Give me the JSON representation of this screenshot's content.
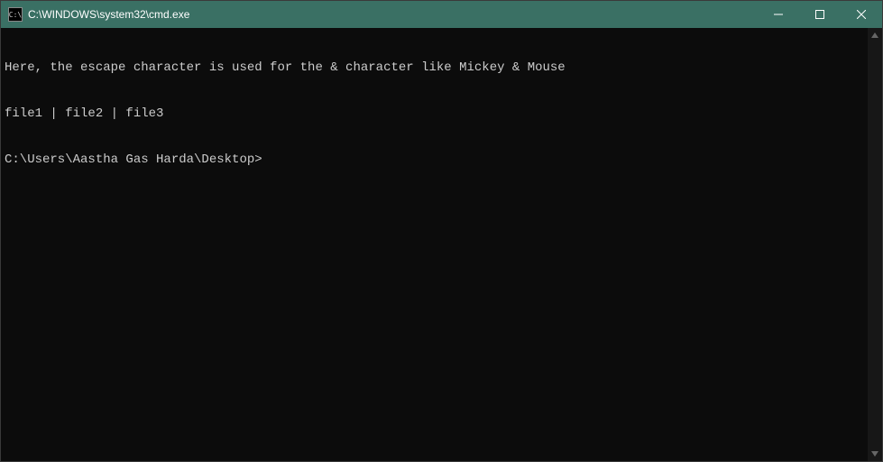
{
  "titlebar": {
    "icon_label": "C:\\",
    "title": "C:\\WINDOWS\\system32\\cmd.exe"
  },
  "terminal": {
    "lines": [
      "Here, the escape character is used for the & character like Mickey & Mouse",
      "file1 | file2 | file3"
    ],
    "prompt": "C:\\Users\\Aastha Gas Harda\\Desktop>"
  },
  "colors": {
    "titlebar_bg": "#3a7064",
    "terminal_bg": "#0c0c0c",
    "terminal_fg": "#cccccc"
  }
}
